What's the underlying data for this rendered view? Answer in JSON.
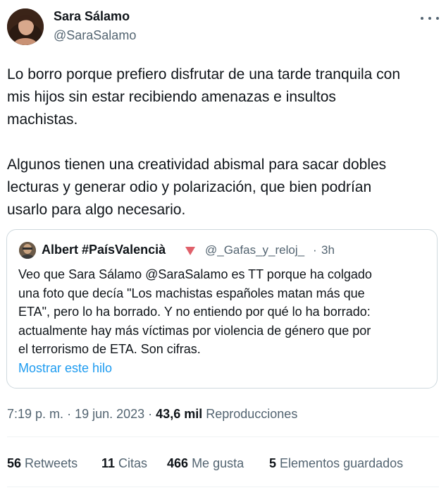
{
  "tweet": {
    "author_name": "Sara Sálamo",
    "author_handle": "@SaraSalamo",
    "text": "Lo borro porque prefiero disfrutar de una tarde tranquila con\nmis hijos sin estar recibiendo amenazas e insultos\nmachistas.\n\nAlgunos tienen una creatividad abismal para sacar dobles\nlecturas y generar odio y polarización, que bien podrían\nusarlo para algo necesario.",
    "time": "7:19 p. m.",
    "date": "19 jun. 2023",
    "views_count": "43,6 mil",
    "views_label": "Reproducciones"
  },
  "quote": {
    "author_name": "Albert #PaísValencià",
    "author_handle": "@_Gafas_y_reloj_",
    "separator": "·",
    "time": "3h",
    "text": "Veo que Sara Sálamo @SaraSalamo es TT porque ha colgado\nuna foto que decía \"Los machistas españoles matan más que\nETA\", pero lo ha borrado. Y no entiendo por qué lo ha borrado:\nactualmente hay más víctimas por violencia de género que por\nel terrorismo de ETA. Son cifras.",
    "show_thread": "Mostrar este hilo"
  },
  "stats": [
    {
      "count": "56",
      "label": "Retweets"
    },
    {
      "count": "11",
      "label": "Citas"
    },
    {
      "count": "466",
      "label": "Me gusta"
    },
    {
      "count": "5",
      "label": "Elementos guardados"
    }
  ],
  "icons": {
    "more": "more-horizontal-icon",
    "flag": "red-triangle-icon"
  },
  "colors": {
    "link": "#1d9bf0",
    "secondary_text": "#536471",
    "primary_text": "#0f1419",
    "border": "#cfd9de",
    "flag": "#e0606a"
  }
}
